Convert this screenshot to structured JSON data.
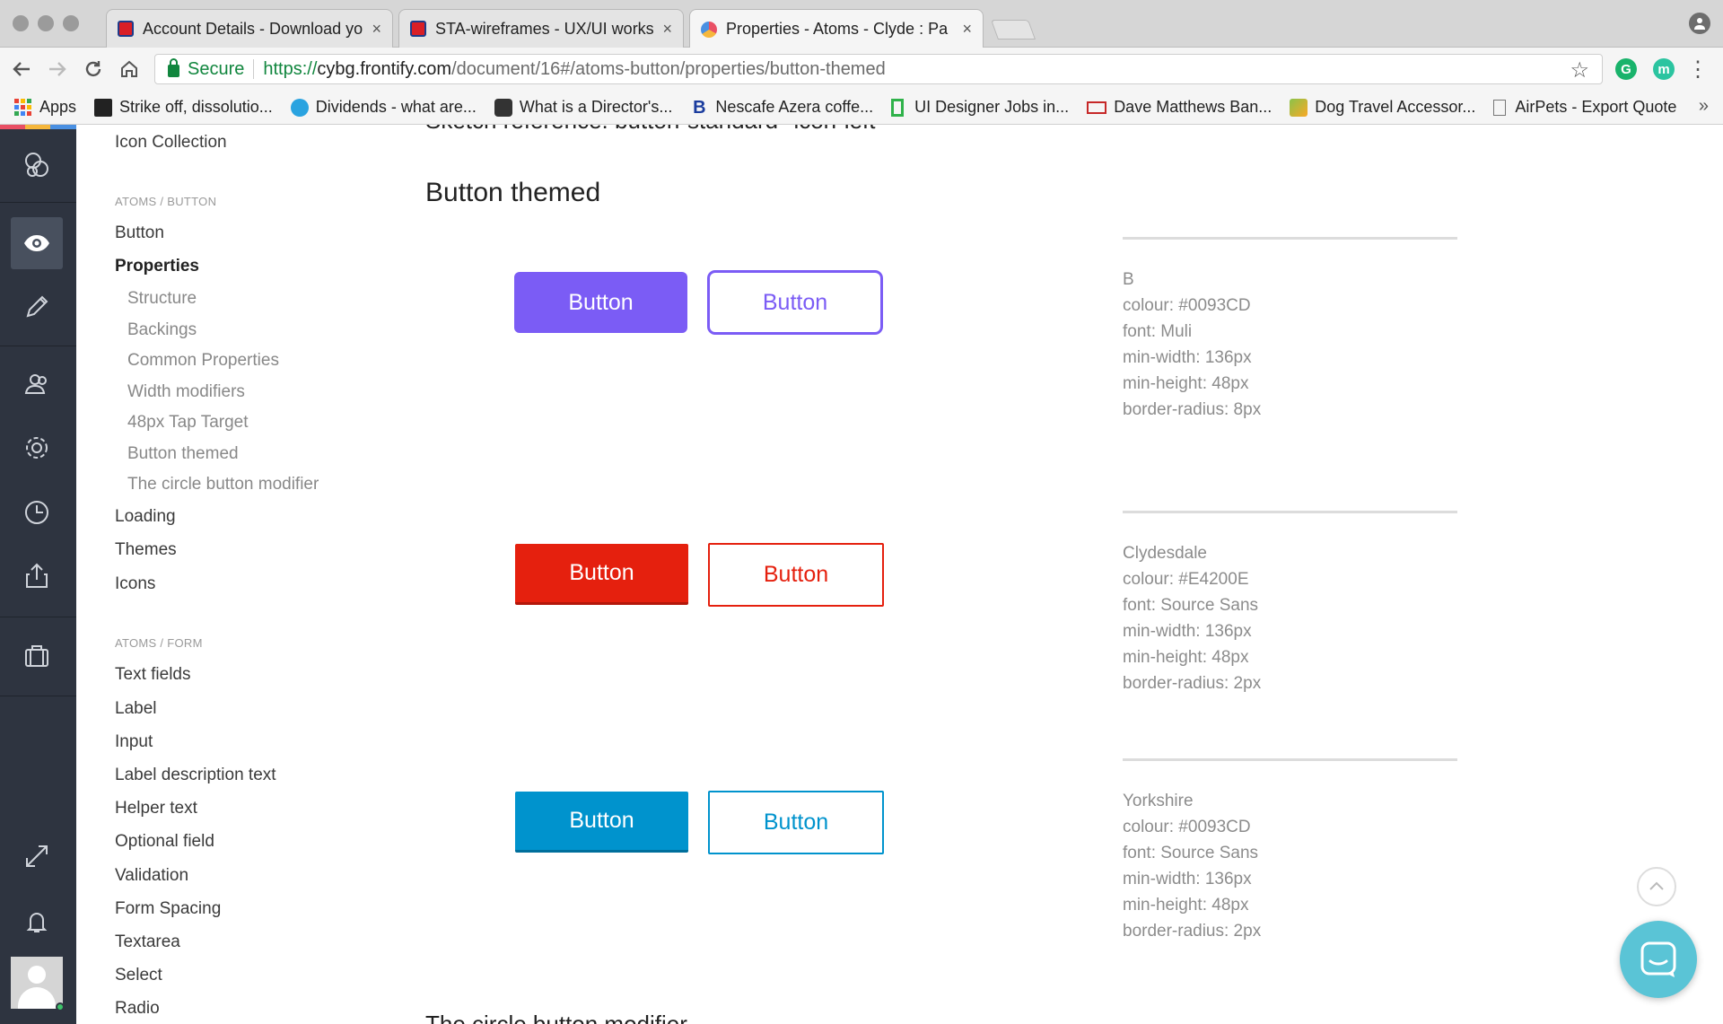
{
  "browser": {
    "tabs": [
      {
        "title": "Account Details - Download yo",
        "favicon": "cybg-favicon",
        "active": false
      },
      {
        "title": "STA-wireframes - UX/UI works",
        "favicon": "cybg-favicon",
        "active": false
      },
      {
        "title": "Properties - Atoms - Clyde : Pa",
        "favicon": "frontify-favicon",
        "active": true
      }
    ],
    "close_glyph": "×",
    "secure_label": "Secure",
    "url_scheme": "https://",
    "url_host": "cybg.frontify.com",
    "url_path": "/document/16#/atoms-button/properties/button-themed",
    "bookmarks": [
      {
        "label": "Apps",
        "icon": "apps-grid-icon"
      },
      {
        "label": "Strike off, dissolutio...",
        "icon": "bookmark-favicon"
      },
      {
        "label": "Dividends - what are...",
        "icon": "bookmark-favicon"
      },
      {
        "label": "What is a Director's...",
        "icon": "bookmark-favicon"
      },
      {
        "label": "Nescafe Azera coffe...",
        "icon": "bookmark-favicon"
      },
      {
        "label": "UI Designer Jobs in...",
        "icon": "bookmark-favicon"
      },
      {
        "label": "Dave Matthews Ban...",
        "icon": "bookmark-favicon"
      },
      {
        "label": "Dog Travel Accessor...",
        "icon": "bookmark-favicon"
      },
      {
        "label": "AirPets - Export Quote",
        "icon": "document-icon"
      }
    ],
    "bookmarks_more": "»",
    "extension_letters": [
      "G",
      "m"
    ]
  },
  "nav": {
    "top_link": "Icon Collection",
    "section_button": "ATOMS / BUTTON",
    "button_items": [
      {
        "label": "Button"
      },
      {
        "label": "Properties"
      },
      {
        "label": "Structure"
      },
      {
        "label": "Backings"
      },
      {
        "label": "Common Properties"
      },
      {
        "label": "Width modifiers"
      },
      {
        "label": "48px Tap Target"
      },
      {
        "label": "Button themed"
      },
      {
        "label": "The circle button modifier"
      },
      {
        "label": "Loading"
      },
      {
        "label": "Themes"
      },
      {
        "label": "Icons"
      }
    ],
    "section_form": "ATOMS / FORM",
    "form_items": [
      {
        "label": "Text fields"
      },
      {
        "label": "Label"
      },
      {
        "label": "Input"
      },
      {
        "label": "Label description text"
      },
      {
        "label": "Helper text"
      },
      {
        "label": "Optional field"
      },
      {
        "label": "Validation"
      },
      {
        "label": "Form Spacing"
      },
      {
        "label": "Textarea"
      },
      {
        "label": "Select"
      },
      {
        "label": "Radio"
      }
    ]
  },
  "main": {
    "cut_top_heading": "Sketch reference: button-standard--icon-left",
    "section_title": "Button themed",
    "cut_bottom_heading": "The circle button modifier",
    "themes": [
      {
        "solid_label": "Button",
        "outline_label": "Button",
        "color": "#7b5cf5",
        "spec": [
          "B",
          "colour: #0093CD",
          "font: Muli",
          "min-width: 136px",
          "min-height: 48px",
          "border-radius: 8px"
        ]
      },
      {
        "solid_label": "Button",
        "outline_label": "Button",
        "color": "#e5200e",
        "spec": [
          "Clydesdale",
          "colour: #E4200E",
          "font: Source Sans",
          "min-width: 136px",
          "min-height: 48px",
          "border-radius: 2px"
        ]
      },
      {
        "solid_label": "Button",
        "outline_label": "Button",
        "color": "#0093cd",
        "spec": [
          "Yorkshire",
          "colour: #0093CD",
          "font: Source Sans",
          "min-width: 136px",
          "min-height: 48px",
          "border-radius: 2px"
        ]
      }
    ]
  },
  "rail": {
    "items": [
      "frontify-logo-icon",
      "eye-icon",
      "pencil-icon",
      "users-icon",
      "gear-icon",
      "clock-icon",
      "share-icon",
      "briefcase-icon",
      "expand-icon",
      "bell-icon",
      "avatar"
    ]
  },
  "colors": {
    "rail_bg": "#2e3440",
    "theme_b": "#7b5cf5",
    "theme_clydesdale": "#e5200e",
    "theme_yorkshire": "#0093cd",
    "chat": "#5ac4d6"
  }
}
